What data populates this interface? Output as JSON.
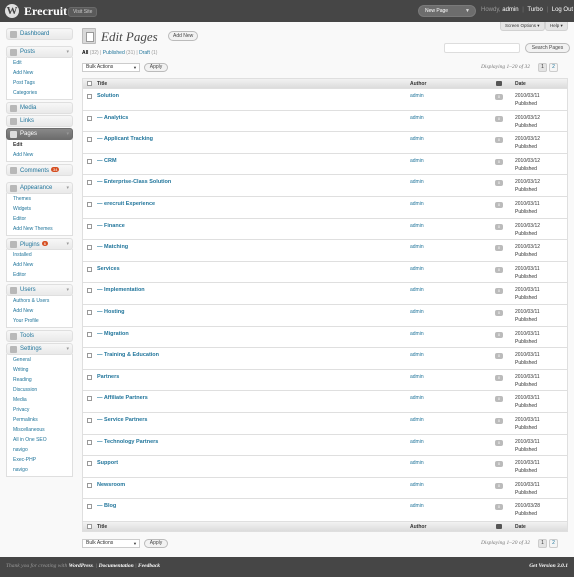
{
  "header": {
    "logo": "W",
    "site_title": "Erecruit",
    "visit_site": "Visit Site",
    "favorite_action": "New Page",
    "howdy": "Howdy,",
    "user": "admin",
    "turbo": "Turbo",
    "logout": "Log Out"
  },
  "screen_meta": {
    "screen_options": "Screen Options ▾",
    "help": "Help ▾"
  },
  "sidebar": {
    "dashboard": "Dashboard",
    "posts": {
      "label": "Posts",
      "items": [
        "Edit",
        "Add New",
        "Post Tags",
        "Categories"
      ]
    },
    "media": "Media",
    "links": "Links",
    "pages": {
      "label": "Pages",
      "items": [
        "Edit",
        "Add New"
      ]
    },
    "comments": {
      "label": "Comments",
      "count": "34"
    },
    "appearance": {
      "label": "Appearance",
      "items": [
        "Themes",
        "Widgets",
        "Editor",
        "Add New Themes"
      ]
    },
    "plugins": {
      "label": "Plugins",
      "count": "6",
      "items": [
        "Installed",
        "Add New",
        "Editor"
      ]
    },
    "users": {
      "label": "Users",
      "items": [
        "Authors & Users",
        "Add New",
        "Your Profile"
      ]
    },
    "tools": "Tools",
    "settings": {
      "label": "Settings",
      "items": [
        "General",
        "Writing",
        "Reading",
        "Discussion",
        "Media",
        "Privacy",
        "Permalinks",
        "Miscellaneous",
        "All in One SEO",
        "navigo",
        "Exec-PHP",
        "navigo"
      ]
    }
  },
  "main": {
    "title": "Edit Pages",
    "add_new": "Add New",
    "filters": {
      "all": "All",
      "all_count": "(32)",
      "published": "Published",
      "published_count": "(31)",
      "draft": "Draft",
      "draft_count": "(1)"
    },
    "search_button": "Search Pages",
    "bulk_actions": "Bulk Actions",
    "apply": "Apply",
    "displaying": "Displaying 1–20 of 32",
    "pages": [
      "1",
      "2"
    ],
    "columns": {
      "title": "Title",
      "author": "Author",
      "date": "Date"
    },
    "rows": [
      {
        "title": "Solution",
        "author": "admin",
        "comments": "0",
        "date": "2010/03/11",
        "status": "Published"
      },
      {
        "title": "— Analytics",
        "author": "admin",
        "comments": "0",
        "date": "2010/03/12",
        "status": "Published"
      },
      {
        "title": "— Applicant Tracking",
        "author": "admin",
        "comments": "0",
        "date": "2010/03/12",
        "status": "Published"
      },
      {
        "title": "— CRM",
        "author": "admin",
        "comments": "0",
        "date": "2010/03/12",
        "status": "Published"
      },
      {
        "title": "— Enterprise-Class Solution",
        "author": "admin",
        "comments": "0",
        "date": "2010/03/12",
        "status": "Published"
      },
      {
        "title": "— erecruit Experience",
        "author": "admin",
        "comments": "0",
        "date": "2010/03/11",
        "status": "Published"
      },
      {
        "title": "— Finance",
        "author": "admin",
        "comments": "0",
        "date": "2010/03/12",
        "status": "Published"
      },
      {
        "title": "— Matching",
        "author": "admin",
        "comments": "0",
        "date": "2010/03/12",
        "status": "Published"
      },
      {
        "title": "Services",
        "author": "admin",
        "comments": "0",
        "date": "2010/03/11",
        "status": "Published"
      },
      {
        "title": "— Implementation",
        "author": "admin",
        "comments": "0",
        "date": "2010/03/11",
        "status": "Published"
      },
      {
        "title": "— Hosting",
        "author": "admin",
        "comments": "0",
        "date": "2010/03/11",
        "status": "Published"
      },
      {
        "title": "— Migration",
        "author": "admin",
        "comments": "0",
        "date": "2010/03/11",
        "status": "Published"
      },
      {
        "title": "— Training & Education",
        "author": "admin",
        "comments": "0",
        "date": "2010/03/11",
        "status": "Published"
      },
      {
        "title": "Partners",
        "author": "admin",
        "comments": "0",
        "date": "2010/03/11",
        "status": "Published"
      },
      {
        "title": "— Affiliate Partners",
        "author": "admin",
        "comments": "0",
        "date": "2010/03/11",
        "status": "Published"
      },
      {
        "title": "— Service Partners",
        "author": "admin",
        "comments": "0",
        "date": "2010/03/11",
        "status": "Published"
      },
      {
        "title": "— Technology Partners",
        "author": "admin",
        "comments": "0",
        "date": "2010/03/11",
        "status": "Published"
      },
      {
        "title": "Support",
        "author": "admin",
        "comments": "0",
        "date": "2010/03/11",
        "status": "Published"
      },
      {
        "title": "Newsroom",
        "author": "admin",
        "comments": "0",
        "date": "2010/03/11",
        "status": "Published"
      },
      {
        "title": "— Blog",
        "author": "admin",
        "comments": "0",
        "date": "2010/03/28",
        "status": "Published"
      }
    ]
  },
  "footer": {
    "thanks": "Thank you for creating with",
    "wordpress": "WordPress",
    "documentation": "Documentation",
    "feedback": "Feedback",
    "version": "Get Version 3.0.1"
  }
}
